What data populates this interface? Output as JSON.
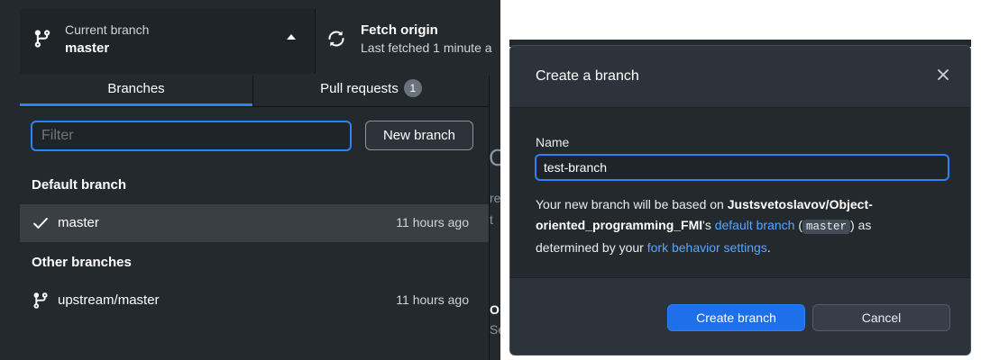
{
  "toolbar": {
    "current_branch_label": "Current branch",
    "current_branch_value": "master",
    "fetch_label": "Fetch origin",
    "fetch_status": "Last fetched 1 minute a"
  },
  "tabs": [
    {
      "label": "Branches"
    },
    {
      "label": "Pull requests",
      "badge": "1"
    }
  ],
  "filter": {
    "placeholder": "Filter"
  },
  "new_branch_button": "New branch",
  "sections": {
    "default": "Default branch",
    "other": "Other branches"
  },
  "branches": {
    "default": [
      {
        "name": "master",
        "time": "11 hours ago",
        "icon": "check-icon"
      }
    ],
    "other": [
      {
        "name": "upstream/master",
        "time": "11 hours ago",
        "icon": "git-branch-icon"
      }
    ]
  },
  "dialog": {
    "title": "Create a branch",
    "name_label": "Name",
    "name_value": "test-branch",
    "desc_prefix": "Your new branch will be based on ",
    "repo": "Justsvetoslavov/Object-oriented_programming_FMI",
    "desc_possessive": "'s ",
    "default_branch_link": "default branch",
    "paren_open": " (",
    "branch_code": "master",
    "paren_close": ") as determined by your ",
    "fork_link": "fork behavior settings",
    "desc_end": ".",
    "create_button": "Create branch",
    "cancel_button": "Cancel"
  },
  "colors": {
    "accent": "#2f81f7",
    "primary_button": "#1f6feb",
    "background": "#24292e",
    "link": "#58a6ff"
  }
}
